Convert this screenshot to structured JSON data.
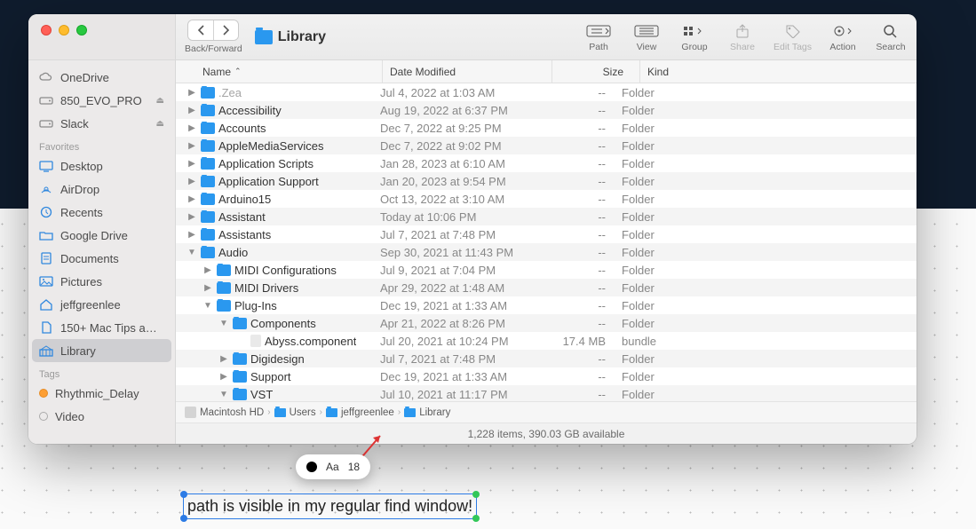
{
  "window": {
    "title": "Library"
  },
  "toolbar": {
    "back_forward_label": "Back/Forward",
    "items": [
      {
        "id": "path",
        "label": "Path",
        "dim": false
      },
      {
        "id": "view",
        "label": "View",
        "dim": false
      },
      {
        "id": "group",
        "label": "Group",
        "dim": false
      },
      {
        "id": "share",
        "label": "Share",
        "dim": true
      },
      {
        "id": "tags",
        "label": "Edit Tags",
        "dim": true
      },
      {
        "id": "action",
        "label": "Action",
        "dim": false
      },
      {
        "id": "search",
        "label": "Search",
        "dim": false
      }
    ]
  },
  "sidebar": {
    "locations": [
      {
        "name": "OneDrive",
        "icon": "cloud",
        "eject": false
      },
      {
        "name": "850_EVO_PRO",
        "icon": "drive",
        "eject": true
      },
      {
        "name": "Slack",
        "icon": "drive",
        "eject": true
      }
    ],
    "favorites_label": "Favorites",
    "favorites": [
      {
        "name": "Desktop",
        "icon": "desktop"
      },
      {
        "name": "AirDrop",
        "icon": "airdrop"
      },
      {
        "name": "Recents",
        "icon": "clock"
      },
      {
        "name": "Google Drive",
        "icon": "folder"
      },
      {
        "name": "Documents",
        "icon": "doc"
      },
      {
        "name": "Pictures",
        "icon": "image"
      },
      {
        "name": "jeffgreenlee",
        "icon": "home"
      },
      {
        "name": "150+ Mac Tips a…",
        "icon": "file"
      },
      {
        "name": "Library",
        "icon": "library",
        "selected": true
      }
    ],
    "tags_label": "Tags",
    "tags": [
      {
        "name": "Rhythmic_Delay",
        "color": "orange"
      },
      {
        "name": "Video",
        "color": "none"
      }
    ]
  },
  "columns": {
    "name": "Name",
    "date": "Date Modified",
    "size": "Size",
    "kind": "Kind",
    "sort_col": "name"
  },
  "rows": [
    {
      "indent": 0,
      "arrow": "right",
      "name": ".Zea",
      "dim": true,
      "date": "Jul 4, 2022 at 1:03 AM",
      "size": "--",
      "kind": "Folder"
    },
    {
      "indent": 0,
      "arrow": "right",
      "name": "Accessibility",
      "date": "Aug 19, 2022 at 6:37 PM",
      "size": "--",
      "kind": "Folder"
    },
    {
      "indent": 0,
      "arrow": "right",
      "name": "Accounts",
      "date": "Dec 7, 2022 at 9:25 PM",
      "size": "--",
      "kind": "Folder"
    },
    {
      "indent": 0,
      "arrow": "right",
      "name": "AppleMediaServices",
      "date": "Dec 7, 2022 at 9:02 PM",
      "size": "--",
      "kind": "Folder"
    },
    {
      "indent": 0,
      "arrow": "right",
      "name": "Application Scripts",
      "date": "Jan 28, 2023 at 6:10 AM",
      "size": "--",
      "kind": "Folder"
    },
    {
      "indent": 0,
      "arrow": "right",
      "name": "Application Support",
      "date": "Jan 20, 2023 at 9:54 PM",
      "size": "--",
      "kind": "Folder"
    },
    {
      "indent": 0,
      "arrow": "right",
      "name": "Arduino15",
      "date": "Oct 13, 2022 at 3:10 AM",
      "size": "--",
      "kind": "Folder"
    },
    {
      "indent": 0,
      "arrow": "right",
      "name": "Assistant",
      "date": "Today at 10:06 PM",
      "size": "--",
      "kind": "Folder"
    },
    {
      "indent": 0,
      "arrow": "right",
      "name": "Assistants",
      "date": "Jul 7, 2021 at 7:48 PM",
      "size": "--",
      "kind": "Folder"
    },
    {
      "indent": 0,
      "arrow": "down",
      "name": "Audio",
      "date": "Sep 30, 2021 at 11:43 PM",
      "size": "--",
      "kind": "Folder"
    },
    {
      "indent": 1,
      "arrow": "right",
      "name": "MIDI Configurations",
      "date": "Jul 9, 2021 at 7:04 PM",
      "size": "--",
      "kind": "Folder"
    },
    {
      "indent": 1,
      "arrow": "right",
      "name": "MIDI Drivers",
      "date": "Apr 29, 2022 at 1:48 AM",
      "size": "--",
      "kind": "Folder"
    },
    {
      "indent": 1,
      "arrow": "down",
      "name": "Plug-Ins",
      "date": "Dec 19, 2021 at 1:33 AM",
      "size": "--",
      "kind": "Folder"
    },
    {
      "indent": 2,
      "arrow": "down",
      "name": "Components",
      "date": "Apr 21, 2022 at 8:26 PM",
      "size": "--",
      "kind": "Folder"
    },
    {
      "indent": 3,
      "arrow": "none",
      "name": "Abyss.component",
      "icon": "doc",
      "date": "Jul 20, 2021 at 10:24 PM",
      "size": "17.4 MB",
      "kind": "bundle"
    },
    {
      "indent": 2,
      "arrow": "right",
      "name": "Digidesign",
      "date": "Jul 7, 2021 at 7:48 PM",
      "size": "--",
      "kind": "Folder"
    },
    {
      "indent": 2,
      "arrow": "right",
      "name": "Support",
      "date": "Dec 19, 2021 at 1:33 AM",
      "size": "--",
      "kind": "Folder"
    },
    {
      "indent": 2,
      "arrow": "down",
      "name": "VST",
      "date": "Jul 10, 2021 at 11:17 PM",
      "size": "--",
      "kind": "Folder"
    }
  ],
  "pathbar": [
    "Macintosh HD",
    "Users",
    "jeffgreenlee",
    "Library"
  ],
  "statusbar": "1,228 items, 390.03 GB available",
  "annotation": {
    "text": "path is visible in my regular find window!",
    "pill_font_mode": "Aa",
    "pill_font_size": "18"
  }
}
